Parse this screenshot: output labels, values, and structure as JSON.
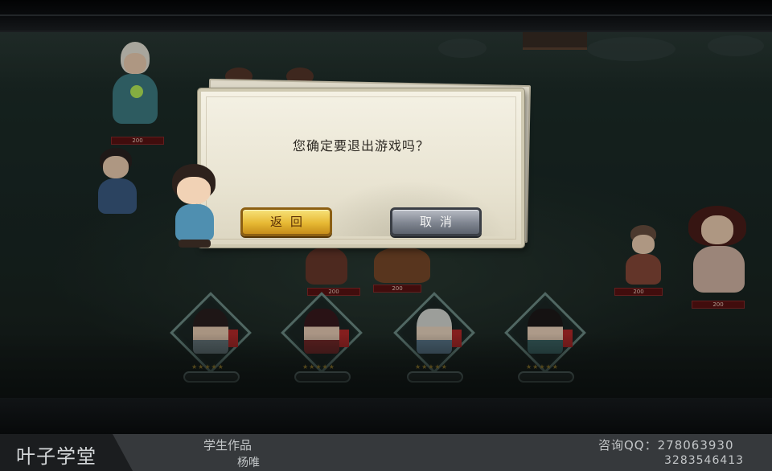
{
  "dialog": {
    "message": "您确定要退出游戏吗？",
    "return_label": "返回",
    "cancel_label": "取消"
  },
  "units": [
    {
      "hp": "200"
    },
    {
      "hp": "200"
    },
    {
      "hp": "200"
    },
    {
      "hp": "200"
    },
    {
      "hp": "200"
    },
    {
      "hp": "200"
    }
  ],
  "footer": {
    "logo": "叶子学堂",
    "work_label": "学生作品",
    "author": "杨唯",
    "qq_label": "咨询QQ：278063930",
    "qq_second": "3283546413"
  },
  "colors": {
    "confirm_button": "#e7b934",
    "cancel_button": "#7f8590",
    "dialog_bg": "#f4f1e4",
    "hp_bar": "#5b1212"
  }
}
